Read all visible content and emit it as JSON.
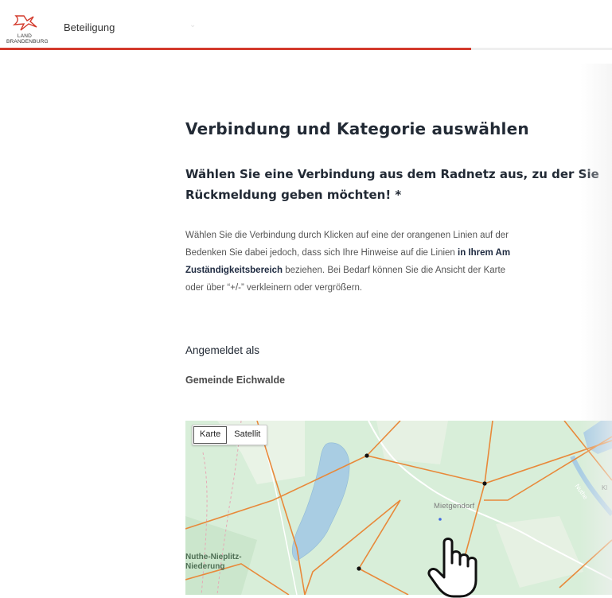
{
  "header": {
    "logo_text_line1": "LAND",
    "logo_text_line2": "BRANDENBURG",
    "nav_title": "Beteiligung",
    "progress_fraction": 0.77,
    "accent_color": "#d33a2c"
  },
  "main": {
    "title": "Verbindung und Kategorie auswählen",
    "question_line1": "Wählen Sie eine Verbindung aus dem Radnetz aus, zu der Sie",
    "question_line2": "Rückmeldung geben möchten! *",
    "desc": {
      "line1": "Wählen Sie die Verbindung durch Klicken auf eine der orangenen Linien auf der",
      "line2_a": "Bedenken Sie dabei jedoch, dass sich Ihre Hinweise auf die Linien ",
      "line2_b": "in Ihrem Am",
      "line3_a": "Zuständigkeitsbereich",
      "line3_b": " beziehen. Bei Bedarf können Sie die Ansicht der Karte",
      "line4": "oder über “+/-” verkleinern oder vergrößern."
    },
    "logged_in_label": "Angemeldet als",
    "logged_in_value": "Gemeinde Eichwalde"
  },
  "map": {
    "toggle_options": [
      "Karte",
      "Satellit"
    ],
    "selected_option": "Karte",
    "town_label": "Mietgendorf",
    "region_label_line1": "Nuthe-Nieplitz-",
    "region_label_line2": "Niederung",
    "kl_label": "Kl",
    "river_label": "Nuthe",
    "line_color": "#e8893a",
    "water_color": "#a9cde3",
    "land_color": "#d8eed9"
  }
}
